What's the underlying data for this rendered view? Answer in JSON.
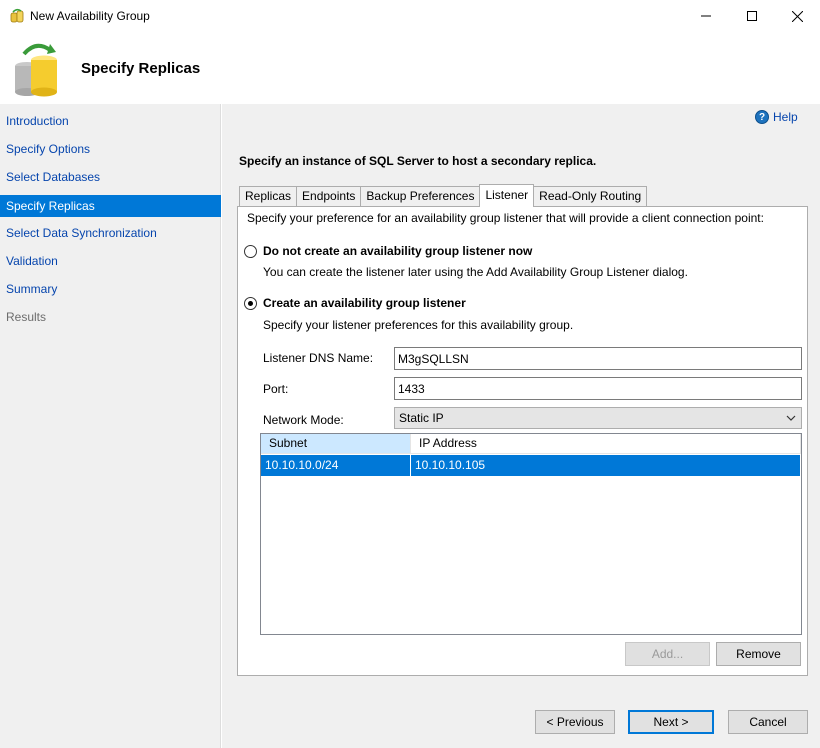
{
  "window": {
    "title": "New Availability Group",
    "minimize": "—",
    "maximize": "☐",
    "close": "✕"
  },
  "header": {
    "title": "Specify Replicas"
  },
  "sidebar": {
    "items": [
      {
        "label": "Introduction",
        "state": "link"
      },
      {
        "label": "Specify Options",
        "state": "link"
      },
      {
        "label": "Select Databases",
        "state": "link"
      },
      {
        "label": "Specify Replicas",
        "state": "active"
      },
      {
        "label": "Select Data Synchronization",
        "state": "link"
      },
      {
        "label": "Validation",
        "state": "link"
      },
      {
        "label": "Summary",
        "state": "link"
      },
      {
        "label": "Results",
        "state": "disabled"
      }
    ]
  },
  "main": {
    "help_label": "Help",
    "help_icon": "?",
    "instruction": "Specify an instance of SQL Server to host a secondary replica.",
    "tabs": [
      {
        "label": "Replicas"
      },
      {
        "label": "Endpoints"
      },
      {
        "label": "Backup Preferences"
      },
      {
        "label": "Listener",
        "active": true
      },
      {
        "label": "Read-Only Routing"
      }
    ],
    "listener": {
      "description": "Specify your preference for an availability group listener that will provide a client connection point:",
      "option_none": {
        "label": "Do not create an availability group listener now",
        "sub": "You can create the listener later using the Add Availability Group Listener dialog.",
        "checked": false
      },
      "option_create": {
        "label": "Create an availability group listener",
        "sub": "Specify your listener preferences for this availability group.",
        "checked": true
      },
      "dns_label": "Listener DNS Name:",
      "dns_value": "M3gSQLLSN",
      "port_label": "Port:",
      "port_value": "1433",
      "mode_label": "Network Mode:",
      "mode_value": "Static IP",
      "grid": {
        "columns": [
          "Subnet",
          "IP Address"
        ],
        "rows": [
          [
            "10.10.10.0/24",
            "10.10.10.105"
          ]
        ]
      },
      "add_label": "Add...",
      "remove_label": "Remove"
    }
  },
  "footer": {
    "previous": "< Previous",
    "next": "Next >",
    "cancel": "Cancel"
  }
}
